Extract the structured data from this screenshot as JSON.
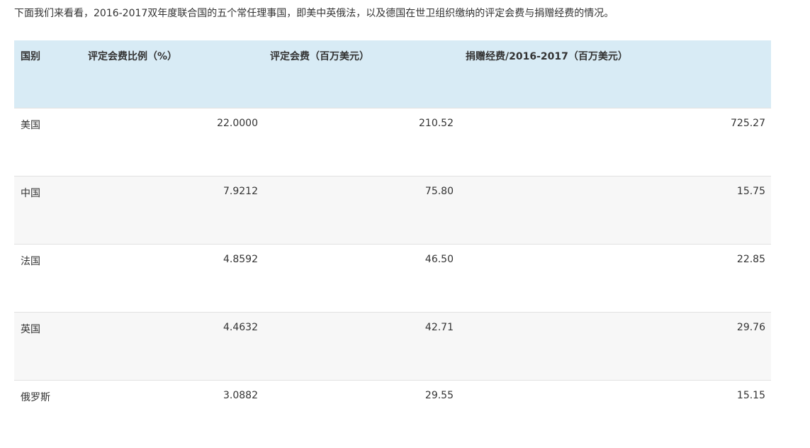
{
  "intro": "下面我们来看看，2016-2017双年度联合国的五个常任理事国，即美中英俄法，以及德国在世卫组织缴纳的评定会费与捐赠经费的情况。",
  "table": {
    "headers": [
      "国别",
      "评定会费比例（%）",
      "评定会费（百万美元）",
      "捐赠经费/2016-2017（百万美元）"
    ],
    "rows": [
      {
        "country": "美国",
        "ratio": "22.0000",
        "assessed": "210.52",
        "donation": "725.27"
      },
      {
        "country": "中国",
        "ratio": "7.9212",
        "assessed": "75.80",
        "donation": "15.75"
      },
      {
        "country": "法国",
        "ratio": "4.8592",
        "assessed": "46.50",
        "donation": "22.85"
      },
      {
        "country": "英国",
        "ratio": "4.4632",
        "assessed": "42.71",
        "donation": "29.76"
      },
      {
        "country": "俄罗斯",
        "ratio": "3.0882",
        "assessed": "29.55",
        "donation": "15.15"
      }
    ]
  }
}
